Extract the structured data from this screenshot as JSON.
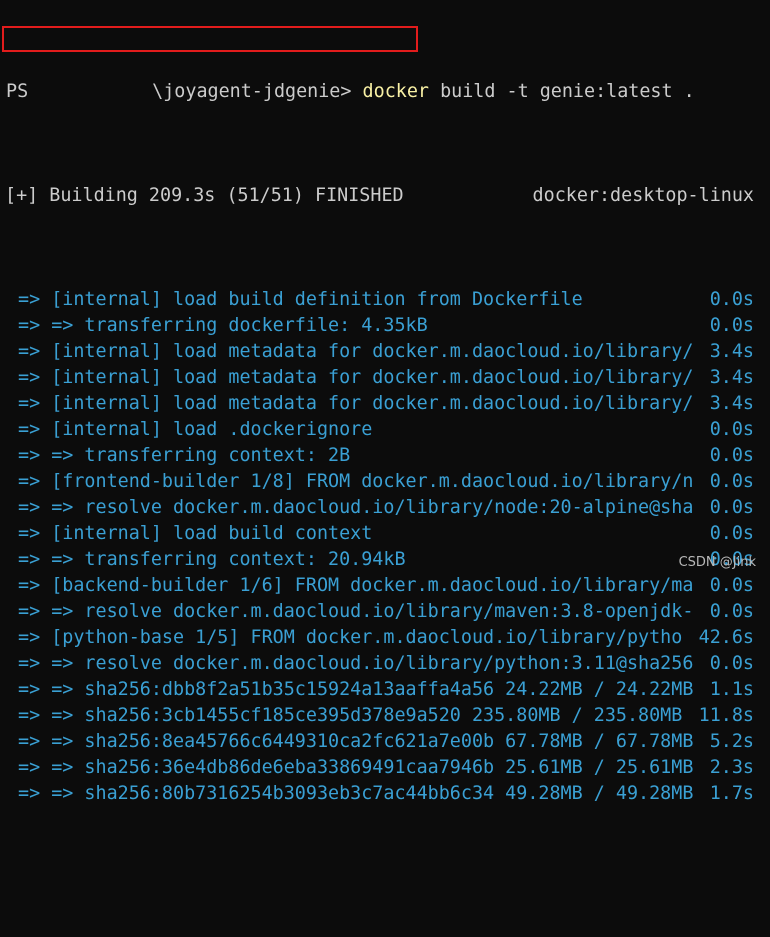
{
  "prompt": {
    "ps": "PS",
    "path": "\\joyagent-jdgenie>",
    "command": "docker",
    "args": "build -t genie:latest ."
  },
  "status": {
    "building": "[+] Building 209.3s (51/51) FINISHED",
    "context": "docker:desktop-linux"
  },
  "steps": [
    {
      "text": "=> [internal] load build definition from Dockerfile",
      "time": "0.0s"
    },
    {
      "text": "=> => transferring dockerfile: 4.35kB",
      "time": "0.0s"
    },
    {
      "text": "=> [internal] load metadata for docker.m.daocloud.io/library/",
      "time": "3.4s"
    },
    {
      "text": "=> [internal] load metadata for docker.m.daocloud.io/library/",
      "time": "3.4s"
    },
    {
      "text": "=> [internal] load metadata for docker.m.daocloud.io/library/",
      "time": "3.4s"
    },
    {
      "text": "=> [internal] load .dockerignore",
      "time": "0.0s"
    },
    {
      "text": "=> => transferring context: 2B",
      "time": "0.0s"
    },
    {
      "text": "=> [frontend-builder 1/8] FROM docker.m.daocloud.io/library/n",
      "time": "0.0s"
    },
    {
      "text": "=> => resolve docker.m.daocloud.io/library/node:20-alpine@sha",
      "time": "0.0s"
    },
    {
      "text": "=> [internal] load build context",
      "time": "0.0s"
    },
    {
      "text": "=> => transferring context: 20.94kB",
      "time": "0.0s"
    },
    {
      "text": "=> [backend-builder 1/6] FROM docker.m.daocloud.io/library/ma",
      "time": "0.0s"
    },
    {
      "text": "=> => resolve docker.m.daocloud.io/library/maven:3.8-openjdk-",
      "time": "0.0s"
    },
    {
      "text": "=> [python-base 1/5] FROM docker.m.daocloud.io/library/pytho",
      "time": "42.6s"
    },
    {
      "text": "=> => resolve docker.m.daocloud.io/library/python:3.11@sha256",
      "time": "0.0s"
    },
    {
      "text": "=> => sha256:dbb8f2a51b35c15924a13aaffa4a56 24.22MB / 24.22MB",
      "time": "1.1s"
    },
    {
      "text": "=> => sha256:3cb1455cf185ce395d378e9a520 235.80MB / 235.80MB",
      "time": "11.8s"
    },
    {
      "text": "=> => sha256:8ea45766c6449310ca2fc621a7e00b 67.78MB / 67.78MB",
      "time": "5.2s"
    },
    {
      "text": "=> => sha256:36e4db86de6eba33869491caa7946b 25.61MB / 25.61MB",
      "time": "2.3s"
    },
    {
      "text": "=> => sha256:80b7316254b3093eb3c7ac44bb6c34 49.28MB / 49.28MB",
      "time": "1.7s"
    }
  ],
  "watermark": "CSDN @Jink",
  "colors": {
    "background": "#0c0c0c",
    "text": "#cccccc",
    "step_text": "#3aa0d4",
    "command": "#f9f1a5",
    "highlight_border": "#e31c1c"
  }
}
